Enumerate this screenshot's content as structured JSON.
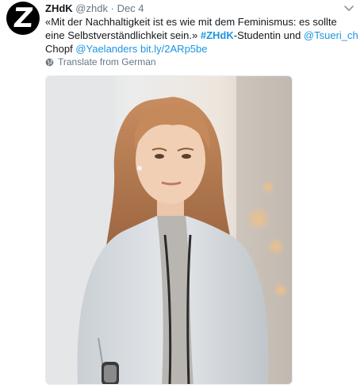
{
  "author": {
    "name": "ZHdK",
    "handle": "@zhdk",
    "separator": "·",
    "date": "Dec 4",
    "avatar_letter": "Z"
  },
  "tweet": {
    "text_1": "«Mit der Nachhaltigkeit ist es wie mit dem Feminismus: es sollte eine Selbstverständlichkeit sein.» ",
    "hashtag": "#ZHdK",
    "text_2": "-Studentin und ",
    "mention_1": "@Tsueri_ch",
    "text_3": " Chopf ",
    "mention_2": "@Yaelanders",
    "text_4": " ",
    "link": "bit.ly/2ARp5be"
  },
  "translate_label": "Translate from German",
  "icons": {
    "caret": "chevron-down-icon",
    "globe": "globe-icon"
  },
  "colors": {
    "link": "#1b95e0",
    "muted": "#657786",
    "text": "#14171a"
  }
}
